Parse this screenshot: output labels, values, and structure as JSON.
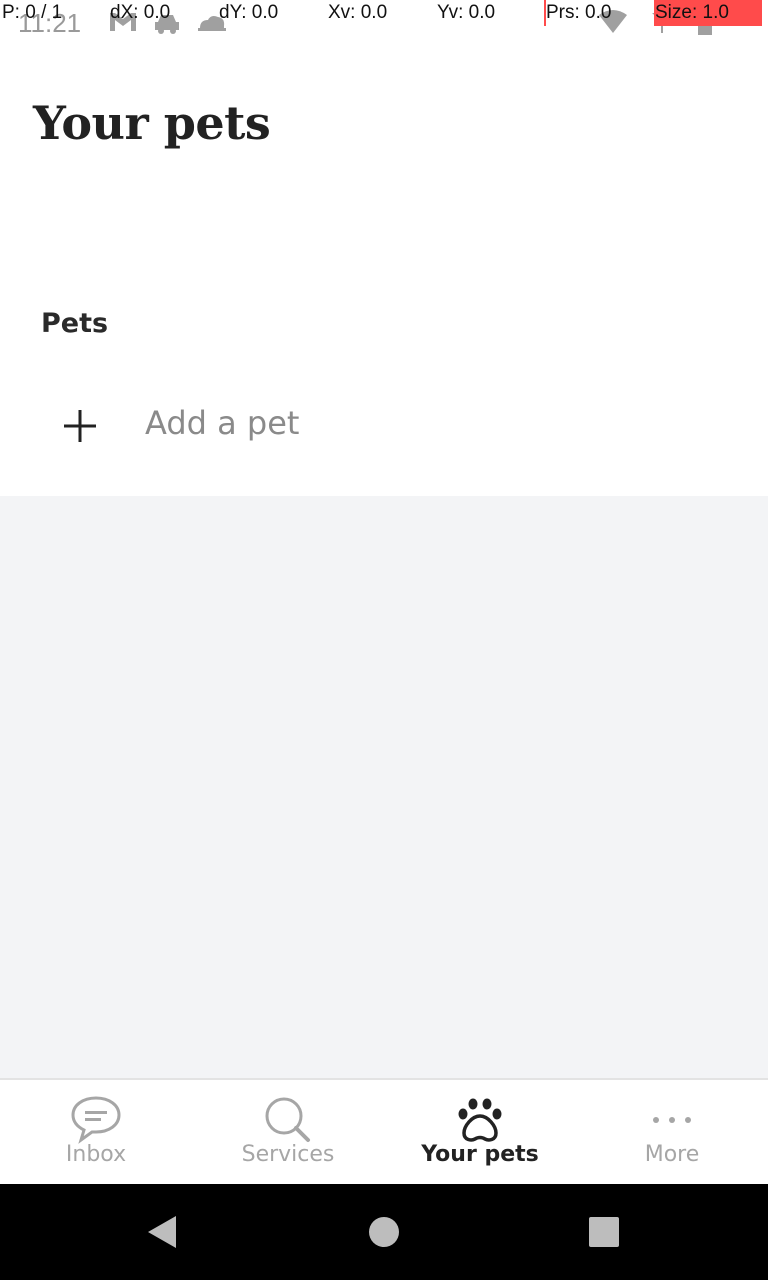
{
  "status_bar": {
    "time": "11:21",
    "icons_left": [
      "gmail-icon",
      "car-icon",
      "cloud-icon"
    ],
    "icons_right": [
      "wifi-icon",
      "signal-icon",
      "battery-icon"
    ]
  },
  "debug_overlay": {
    "pointer": "P: 0 / 1",
    "dx": "dX: 0.0",
    "dy": "dY: 0.0",
    "xv": "Xv: 0.0",
    "yv": "Yv: 0.0",
    "prs": "Prs: 0.0",
    "size": "Size: 1.0"
  },
  "header": {
    "title": "Your pets"
  },
  "pets_section": {
    "label": "Pets",
    "add_pet": {
      "icon": "plus-icon",
      "label": "Add a pet"
    }
  },
  "bottom_nav": {
    "items": [
      {
        "label": "Inbox",
        "icon": "chat-bubble-icon",
        "active": false
      },
      {
        "label": "Services",
        "icon": "search-icon",
        "active": false
      },
      {
        "label": "Your pets",
        "icon": "paw-icon",
        "active": true
      },
      {
        "label": "More",
        "icon": "more-dots-icon",
        "active": false
      }
    ]
  },
  "system_nav": {
    "buttons": [
      "back-icon",
      "home-icon",
      "recents-icon"
    ]
  },
  "colors": {
    "text_primary": "#222222",
    "text_muted": "#8a8a8a",
    "nav_inactive": "#a6a6a6",
    "content_bg": "#f3f4f6",
    "overlay_red": "#ff4b4b"
  }
}
